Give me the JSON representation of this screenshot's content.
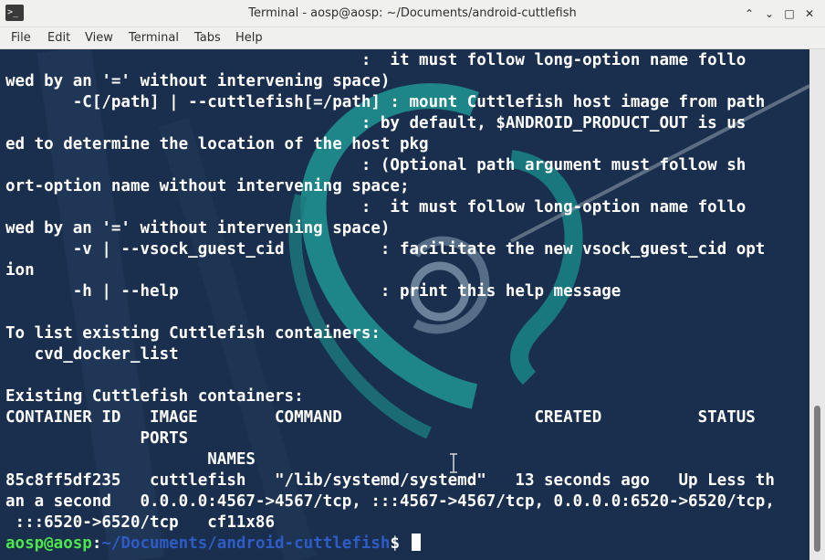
{
  "window": {
    "title": "Terminal - aosp@aosp: ~/Documents/android-cuttlefish",
    "app_icon": "terminal-icon",
    "app_icon_glyph": ">_",
    "controls": {
      "minimize": "⌃",
      "restore": "⌄",
      "maximize": "□",
      "close": "✕"
    }
  },
  "menubar": {
    "file": "File",
    "edit": "Edit",
    "view": "View",
    "terminal": "Terminal",
    "tabs": "Tabs",
    "help": "Help"
  },
  "terminal": {
    "lines": [
      "                                     :  it must follow long-option name follo",
      "wed by an '=' without intervening space)",
      "       -C[/path] | --cuttlefish[=/path] : mount Cuttlefish host image from path",
      "                                     : by default, $ANDROID_PRODUCT_OUT is us",
      "ed to determine the location of the host pkg",
      "                                     : (Optional path argument must follow sh",
      "ort-option name without intervening space;",
      "                                     :  it must follow long-option name follo",
      "wed by an '=' without intervening space)",
      "       -v | --vsock_guest_cid          : facilitate the new vsock_guest_cid opt",
      "ion",
      "       -h | --help                     : print this help message",
      "",
      "To list existing Cuttlefish containers:",
      "   cvd_docker_list",
      "",
      "Existing Cuttlefish containers:",
      "CONTAINER ID   IMAGE        COMMAND                    CREATED          STATUS",
      "              PORTS",
      "                     NAMES",
      "85c8ff5df235   cuttlefish   \"/lib/systemd/systemd\"   13 seconds ago   Up Less th",
      "an a second   0.0.0.0:4567->4567/tcp, :::4567->4567/tcp, 0.0.0.0:6520->6520/tcp,",
      " :::6520->6520/tcp   cf11x86"
    ],
    "prompt_user": "aosp@aosp",
    "prompt_sep": ":",
    "prompt_path": "~/Documents/android-cuttlefish",
    "prompt_symbol": "$"
  },
  "colors": {
    "terminal_bg": "#1a2f4d",
    "text": "#ffffff",
    "prompt_user": "#4ce64c",
    "prompt_path": "#2e5cc7",
    "swirl": "#1f8f8f"
  }
}
